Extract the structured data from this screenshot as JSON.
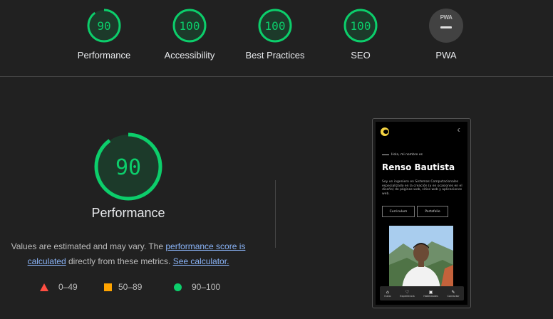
{
  "summary": [
    {
      "label": "Performance",
      "score": "90",
      "value": 90
    },
    {
      "label": "Accessibility",
      "score": "100",
      "value": 100
    },
    {
      "label": "Best Practices",
      "score": "100",
      "value": 100
    },
    {
      "label": "SEO",
      "score": "100",
      "value": 100
    }
  ],
  "pwa": {
    "label": "PWA",
    "badge_text": "PWA"
  },
  "performance": {
    "score": "90",
    "value": 90,
    "title": "Performance",
    "desc_start": "Values are estimated and may vary. The ",
    "link_score": "performance score is calculated",
    "desc_mid": " directly from these metrics. ",
    "link_calc": "See calculator."
  },
  "legend": {
    "fail": "0–49",
    "average": "50–89",
    "pass": "90–100"
  },
  "colors": {
    "pass": "#0cce6b",
    "average": "#ffa400",
    "fail": "#ff4e42",
    "background": "#212121",
    "link": "#8ab4f8"
  },
  "screenshot": {
    "greeting": "Hola, mi nombre es",
    "name": "Renso Bautista",
    "bio": "Soy un ingeniero en Sistemas Computacionales especializado en la creación (y en ocasiones en el diseño) de páginas web, sitios web y aplicaciones web.",
    "btn_cv": "Curriculum",
    "btn_portfolio": "Portafolio",
    "nav": [
      {
        "icon": "home-icon",
        "label": "Inicio"
      },
      {
        "icon": "experience-icon",
        "label": "Experiencia"
      },
      {
        "icon": "skills-icon",
        "label": "Habilidades"
      },
      {
        "icon": "contact-icon",
        "label": "Contactar"
      }
    ]
  }
}
